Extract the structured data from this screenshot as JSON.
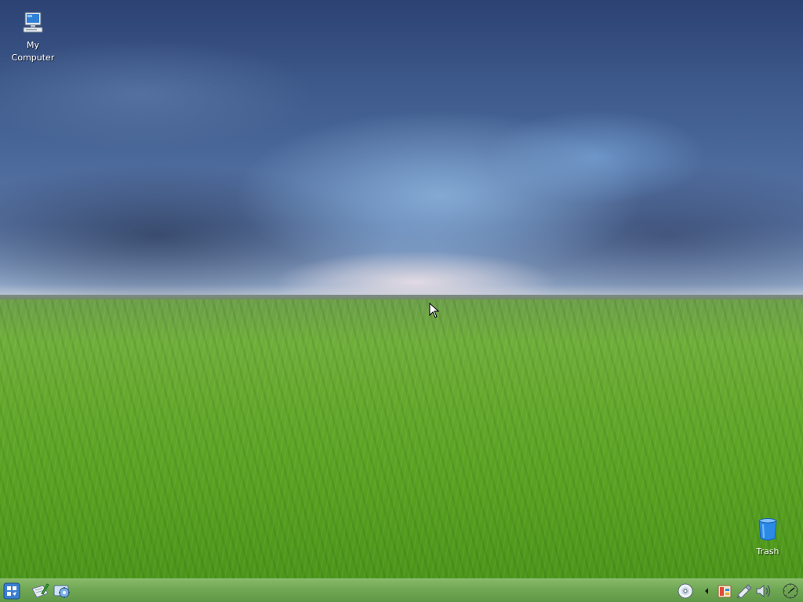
{
  "desktop": {
    "icons": [
      {
        "label": "My\nComputer",
        "icon": "computer-icon"
      },
      {
        "label": "Trash",
        "icon": "trash-icon"
      }
    ]
  },
  "taskbar": {
    "launchers": [
      {
        "icon": "start-menu-icon"
      },
      {
        "icon": "text-editor-icon"
      },
      {
        "icon": "settings-icon"
      }
    ],
    "tray": [
      {
        "icon": "cd-drive-icon"
      },
      {
        "icon": "expand-arrow-icon"
      },
      {
        "icon": "package-manager-icon"
      },
      {
        "icon": "network-icon"
      },
      {
        "icon": "volume-icon"
      },
      {
        "icon": "clock-icon"
      }
    ]
  },
  "colors": {
    "taskbar": "#6ea652",
    "sky": "#3e5a8c",
    "grass": "#57a020",
    "label_text": "#ffffff"
  }
}
